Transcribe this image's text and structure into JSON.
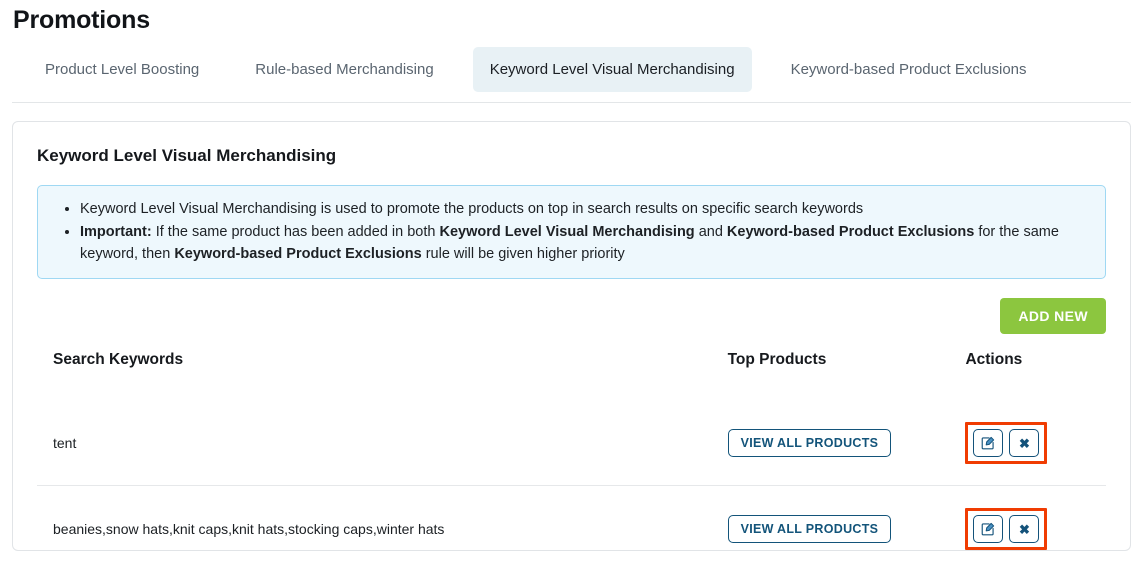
{
  "header": {
    "title": "Promotions"
  },
  "tabs": [
    {
      "label": "Product Level Boosting",
      "active": false
    },
    {
      "label": "Rule-based Merchandising",
      "active": false
    },
    {
      "label": "Keyword Level Visual Merchandising",
      "active": true
    },
    {
      "label": "Keyword-based Product Exclusions",
      "active": false
    }
  ],
  "card": {
    "title": "Keyword Level Visual Merchandising",
    "info": {
      "bullet_1": "Keyword Level Visual Merchandising is used to promote the products on top in search results on specific search keywords",
      "bullet_2": {
        "lead": "Important:",
        "part_1": " If the same product has been added in both ",
        "strong_1": "Keyword Level Visual Merchandising",
        "part_2": " and ",
        "strong_2": "Keyword-based Product Exclusions",
        "part_3": " for the same keyword, then ",
        "strong_3": "Keyword-based Product Exclusions",
        "part_4": " rule will be given higher priority"
      }
    },
    "add_new_label": "ADD NEW",
    "table": {
      "columns": [
        "Search Keywords",
        "Top Products",
        "Actions"
      ],
      "rows": [
        {
          "keywords": "tent",
          "view_products_label": "VIEW ALL PRODUCTS",
          "edit_icon": "edit-pencil-icon",
          "delete_icon": "close-x-icon",
          "delete_glyph": "✖"
        },
        {
          "keywords": "beanies,snow hats,knit caps,knit hats,stocking caps,winter hats",
          "view_products_label": "VIEW ALL PRODUCTS",
          "edit_icon": "edit-pencil-icon",
          "delete_icon": "close-x-icon",
          "delete_glyph": "✖"
        }
      ]
    }
  },
  "colors": {
    "accent_green": "#8cc63f",
    "navy": "#13547a",
    "highlight_red": "#f03c02",
    "info_bg": "#eef8fd",
    "info_border": "#9fd8f3",
    "active_tab_bg": "#e8f1f5"
  }
}
